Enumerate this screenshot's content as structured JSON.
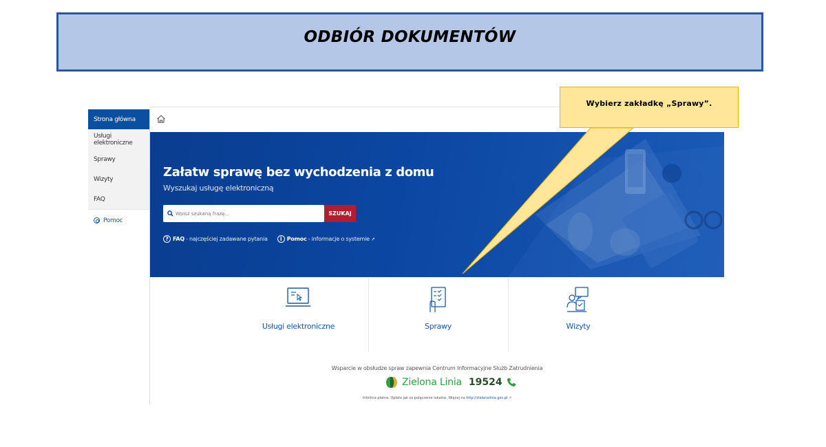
{
  "slide": {
    "title": "ODBIÓR DOKUMENTÓW"
  },
  "sidebar": {
    "items": [
      {
        "label": "Strona główna",
        "active": true
      },
      {
        "label": "Usługi elektroniczne"
      },
      {
        "label": "Sprawy"
      },
      {
        "label": "Wizyty"
      },
      {
        "label": "FAQ"
      }
    ],
    "help_label": "Pomoc"
  },
  "topbar": {
    "home_icon": "home-icon"
  },
  "hero": {
    "title": "Załatw sprawę bez wychodzenia z domu",
    "subtitle": "Wyszukaj usługę elektroniczną",
    "search_placeholder": "Wpisz szukaną frazę...",
    "search_button": "SZUKAJ",
    "faq_bold": "FAQ",
    "faq_text": " - najczęściej zadawane pytania",
    "help_bold": "Pomoc",
    "help_text": " - informacje o systemie"
  },
  "tiles": [
    {
      "label": "Usługi elektroniczne",
      "icon": "laptop-icon"
    },
    {
      "label": "Sprawy",
      "icon": "document-checklist-icon"
    },
    {
      "label": "Wizyty",
      "icon": "visit-chat-icon"
    }
  ],
  "footer": {
    "support_text": "Wsparcie w obsłudze spraw zapewnia Centrum Informacyjne Służb Zatrudnienia",
    "line_name": "Zielona Linia",
    "line_number": "19524",
    "small_text": "Infolinia płatna. Opłata jak za połączenie lokalne. Więcej na ",
    "small_link": "http://zielonalinia.gov.pl"
  },
  "callout": {
    "text": "Wybierz zakładkę „Sprawy”."
  },
  "colors": {
    "primary": "#0b47a3",
    "search_button": "#b01e2f",
    "callout_fill": "#ffe699",
    "banner_fill": "#b4c7e7",
    "banner_border": "#2f5597",
    "green_line": "#2e9e3e"
  }
}
